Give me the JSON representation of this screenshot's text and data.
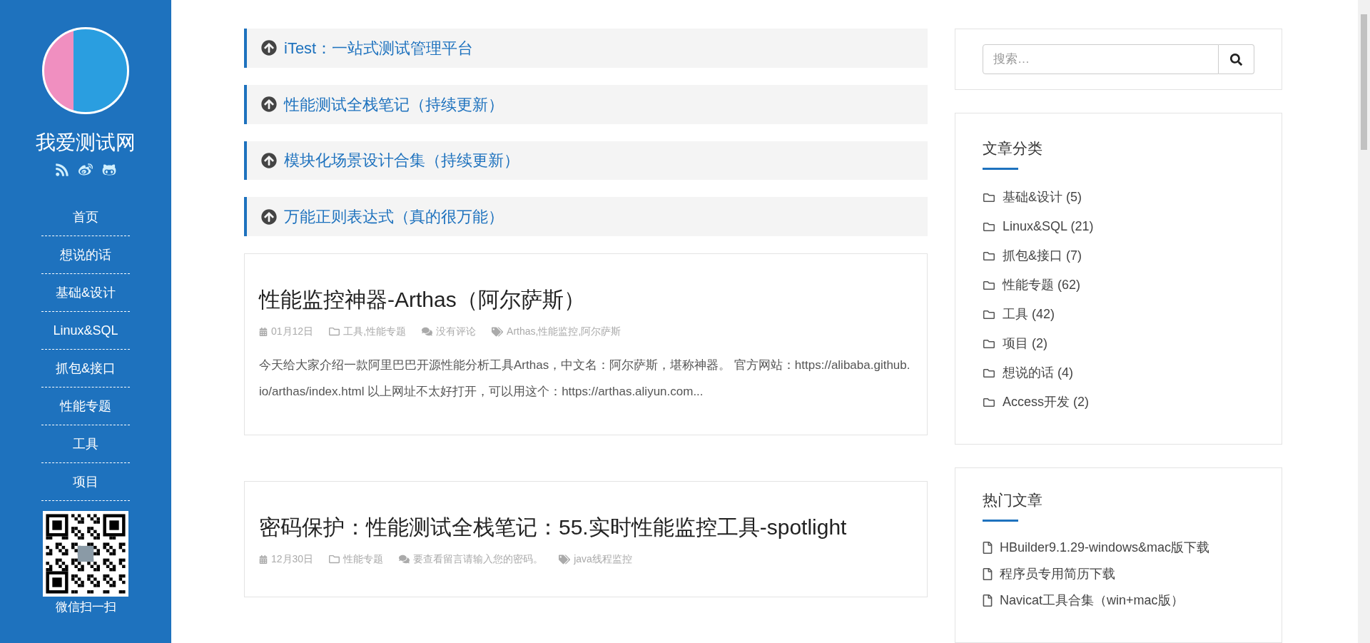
{
  "sidebar": {
    "site_title": "我爱测试网",
    "nav": [
      {
        "label": "首页"
      },
      {
        "label": "想说的话"
      },
      {
        "label": "基础&设计"
      },
      {
        "label": "Linux&SQL"
      },
      {
        "label": "抓包&接口"
      },
      {
        "label": "性能专题"
      },
      {
        "label": "工具"
      },
      {
        "label": "项目"
      }
    ],
    "qr_caption": "微信扫一扫"
  },
  "sticky_posts": [
    {
      "title": "iTest：一站式测试管理平台"
    },
    {
      "title": "性能测试全栈笔记（持续更新）"
    },
    {
      "title": "模块化场景设计合集（持续更新）"
    },
    {
      "title": "万能正则表达式（真的很万能）"
    }
  ],
  "posts": [
    {
      "title": "性能监控神器-Arthas（阿尔萨斯）",
      "date": "01月12日",
      "categories": "工具,性能专题",
      "comments": "没有评论",
      "tags": "Arthas,性能监控,阿尔萨斯",
      "excerpt": "今天给大家介绍一款阿里巴巴开源性能分析工具Arthas，中文名：阿尔萨斯，堪称神器。 官方网站：https://alibaba.github.io/arthas/index.html 以上网址不太好打开，可以用这个：https://arthas.aliyun.com..."
    },
    {
      "title": "密码保护：性能测试全栈笔记：55.实时性能监控工具-spotlight",
      "date": "12月30日",
      "categories": "性能专题",
      "comments": "要查看留言请输入您的密码。",
      "tags": "java线程监控"
    }
  ],
  "search": {
    "placeholder": "搜索…"
  },
  "categories": {
    "title": "文章分类",
    "items": [
      {
        "label": "基础&设计 (5)"
      },
      {
        "label": "Linux&SQL (21)"
      },
      {
        "label": "抓包&接口 (7)"
      },
      {
        "label": "性能专题 (62)"
      },
      {
        "label": "工具 (42)"
      },
      {
        "label": "项目 (2)"
      },
      {
        "label": "想说的话 (4)"
      },
      {
        "label": "Access开发 (2)"
      }
    ]
  },
  "hot": {
    "title": "热门文章",
    "items": [
      {
        "label": "HBuilder9.1.29-windows&mac版下载"
      },
      {
        "label": "程序员专用简历下载"
      },
      {
        "label": "Navicat工具合集（win+mac版）"
      }
    ]
  }
}
